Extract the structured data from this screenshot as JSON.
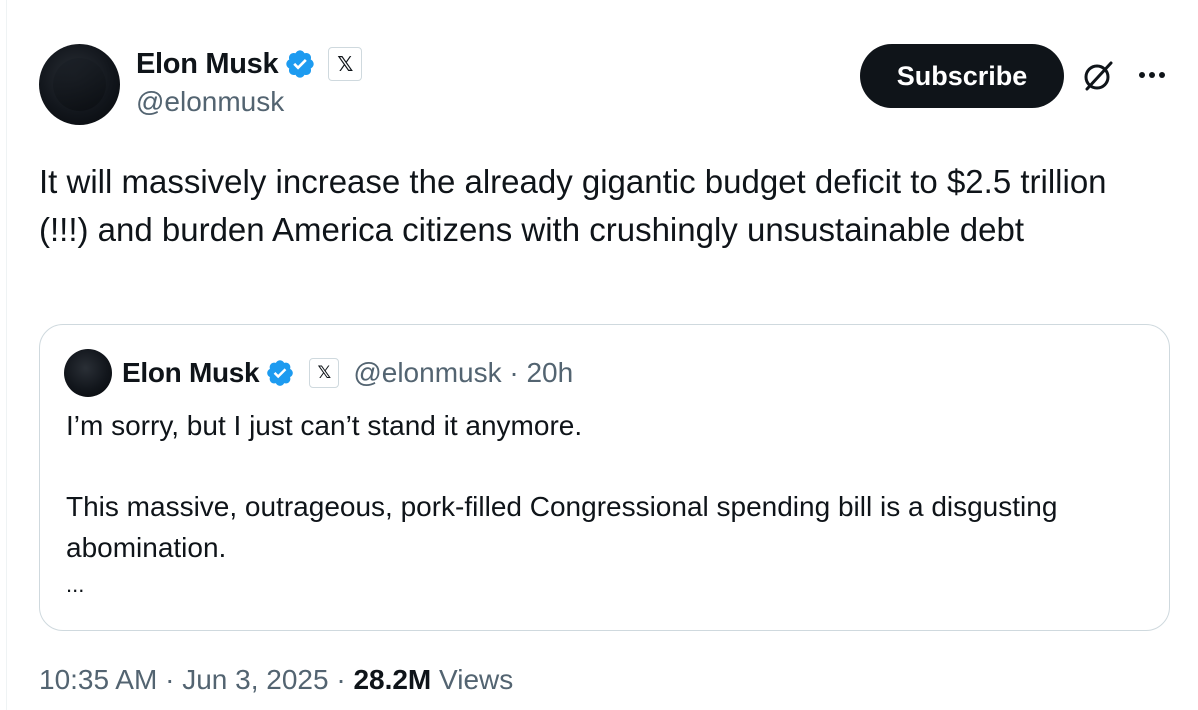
{
  "author": {
    "name": "Elon Musk",
    "handle": "@elonmusk",
    "verified_icon": "verified-badge-icon",
    "affiliate_icon": "x-logo-icon",
    "badge_color": "#1d9bf0"
  },
  "actions": {
    "subscribe_label": "Subscribe",
    "grok_icon": "grok-icon",
    "more_icon": "more-dots-icon",
    "more_label": "···"
  },
  "post": {
    "text": "It will massively increase the already gigantic budget deficit to $2.5 trillion (!!!) and burden America citizens with crushingly unsustainable debt"
  },
  "quote": {
    "name": "Elon Musk",
    "handle_time": "@elonmusk · 20h",
    "paragraph1": "I’m sorry, but I just can’t stand it anymore.",
    "paragraph2": "This massive, outrageous, pork-filled Congressional spending bill is a disgusting abomination.",
    "ellipsis": "..."
  },
  "footer": {
    "time": "10:35 AM",
    "date": "Jun 3, 2025",
    "separator": " · ",
    "views_count": "28.2M",
    "views_label": "Views"
  }
}
